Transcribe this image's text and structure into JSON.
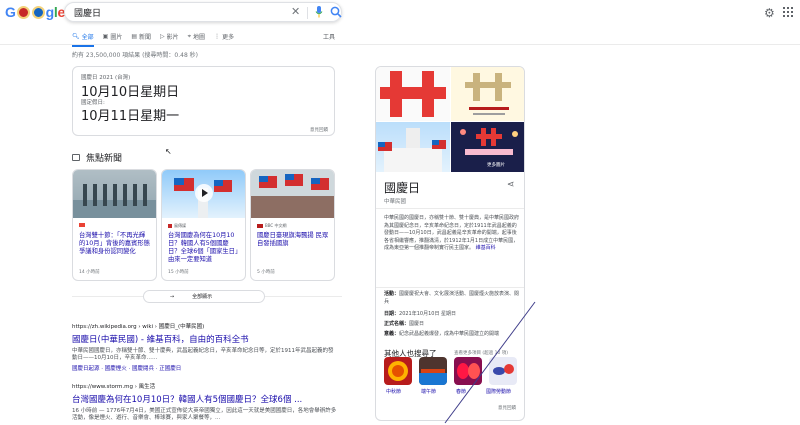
{
  "logo": {
    "chars": [
      "G",
      "g",
      "l",
      "e"
    ]
  },
  "search": {
    "query": "國慶日"
  },
  "tabs": [
    {
      "label": "全部",
      "icon": "search-icon"
    },
    {
      "label": "圖片",
      "icon": "image-icon"
    },
    {
      "label": "新聞",
      "icon": "news-icon"
    },
    {
      "label": "影片",
      "icon": "video-icon"
    },
    {
      "label": "地圖",
      "icon": "map-pin-icon"
    },
    {
      "label": "更多",
      "icon": "more-icon"
    }
  ],
  "tools_label": "工具",
  "stats": "約有 23,500,000 項結果 (搜尋時間：0.48 秒)",
  "date_card": {
    "label1": "國慶日 2021 (台灣)",
    "date1": "10月10日星期日",
    "label2": "國定假日:",
    "date2": "10月11日星期一",
    "feedback": "意見回饋"
  },
  "news": {
    "heading": "焦點新聞",
    "cards": [
      {
        "source": "",
        "title": "台灣雙十節：「不再光輝的10月」背後的嘉賓形態爭議和身份認同變化",
        "time": "14 小時前"
      },
      {
        "source": "風傳媒",
        "title": "台灣國慶為何在10月10日？韓國人有5個國慶日？全球6個「國家生日」由來一定要知道",
        "time": "15 小時前"
      },
      {
        "source": "BBC 中文網",
        "title": "國慶日臺現旗海飄揚 民眾自發插國旗",
        "time": "5 小時前"
      }
    ],
    "more_label": "全部顯示"
  },
  "results": [
    {
      "url": "https://zh.wikipedia.org › wiki › 國慶日_(中華民國)",
      "title": "國慶日(中華民國) - 維基百科，自由的百科全书",
      "snippet": "中華民國國慶日，亦稱雙十節、雙十慶典，武昌起義紀念日，辛亥革命紀念日等，定於1911年武昌起義的發動日——10月10日，辛亥革命……",
      "links": "國慶日起源 · 國慶煙火 · 國慶閱兵 · 正國慶日"
    },
    {
      "url": "https://www.storm.mg › 風生活",
      "title": "台灣國慶為何在10月10日？韓國人有5個國慶日？全球6個 ...",
      "snippet": "16 小時前 — 1776年7月4日，美國正式宣佈從大英帝國獨立，因此這一天就是美國國慶日，各地會舉辦許多活動，像是煙火、遊行、音樂會、棒球賽，與家人聚餐等，..."
    }
  ],
  "kp": {
    "title": "國慶日",
    "subtitle": "中華民國",
    "more_images": "更多圖片",
    "description": "中華民國的國慶日，亦稱雙十節、雙十慶典，是中華民國政府為其國慶紀念日，辛亥革命紀念日，定於1911年武昌起義的發動日——10月10日，武昌起義是辛亥革命的開端，起事後各省相繼響應，推翻滿清，於1912年1月1日成立中華民國，成為東亞第一個推翻帝制實行民主國家。",
    "wiki_link": "維基百科",
    "activities_label": "活動：",
    "activities": "國慶慶祝大會、文化展演活動、國慶煙火施放表演、閱兵",
    "date_label": "日期：",
    "date": "2021年10月10日 星期日",
    "official_label": "正式名稱：",
    "official": "國慶日",
    "meaning_label": "意義：",
    "meaning": "紀念武昌起義爆發，成為中華民國建立的開端",
    "also_heading": "其他人也搜尋了",
    "also_more": "查看更多項目 (超過 10 項)",
    "also": [
      "中秋節",
      "端午節",
      "春節",
      "國際勞動節"
    ],
    "feedback": "意見回饋"
  },
  "colors": {
    "link": "#1a0dab",
    "accent": "#1a73e8",
    "flag_red": "#d32f2f"
  }
}
